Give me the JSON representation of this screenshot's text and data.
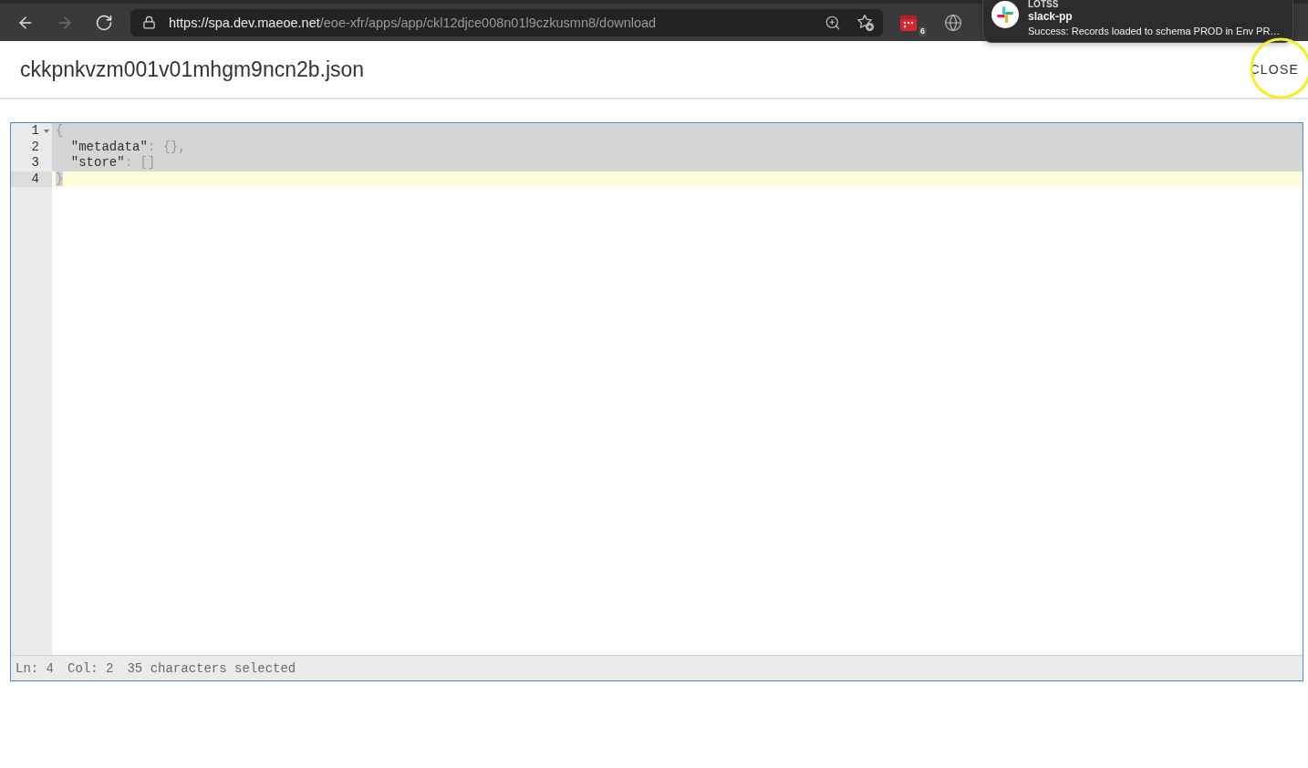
{
  "browser": {
    "nav_buttons": [
      {
        "kind": "back",
        "disabled": false
      },
      {
        "kind": "forward",
        "disabled": true
      },
      {
        "kind": "reload",
        "disabled": false
      }
    ],
    "url": {
      "host": "https://spa.dev.maeoe.net",
      "path": "/eoe-xfr/apps/app/ckl12djce008n01l9czkusmn8/download"
    },
    "extension_badge": "6"
  },
  "notification": {
    "title": "LOTSS",
    "sender": "slack-pp",
    "message": "Success: Records loaded to schema PROD in Env PR…"
  },
  "header": {
    "title": "ckkpnkvzm001v01mhgm9ncn2b.json",
    "close_label": "CLOSE"
  },
  "editor": {
    "lines": [
      {
        "number": "1",
        "foldable": true,
        "selected": true,
        "active": false,
        "tokens": [
          {
            "kind": "punct",
            "text": "{"
          }
        ]
      },
      {
        "number": "2",
        "foldable": false,
        "selected": true,
        "active": false,
        "tokens": [
          {
            "kind": "key",
            "text": "  \"metadata\""
          },
          {
            "kind": "punct",
            "text": ": {},"
          }
        ]
      },
      {
        "number": "3",
        "foldable": false,
        "selected": true,
        "active": false,
        "tokens": [
          {
            "kind": "key",
            "text": "  \"store\""
          },
          {
            "kind": "punct",
            "text": ": []"
          }
        ]
      },
      {
        "number": "4",
        "foldable": false,
        "selected": true,
        "active": true,
        "tokens": [
          {
            "kind": "punct",
            "text": "}"
          }
        ]
      }
    ],
    "status_bar": {
      "line": "Ln: 4",
      "column": "Col: 2",
      "selection": "35 characters selected"
    }
  }
}
